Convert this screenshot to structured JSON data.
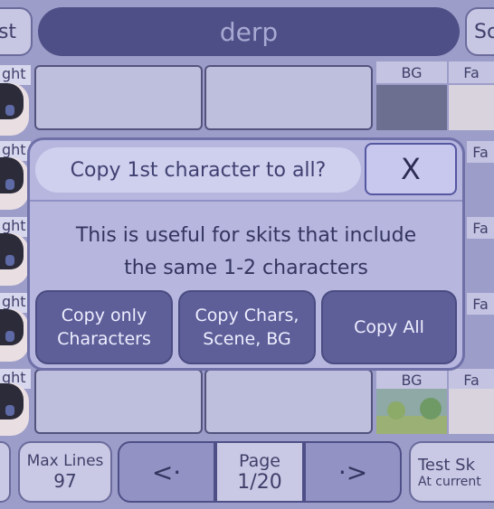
{
  "header": {
    "left_button_label": "st",
    "project_title": "derp",
    "right_button_label": "Sc"
  },
  "rows": [
    {
      "label": "ght"
    },
    {
      "label": "ght"
    },
    {
      "label": "ght"
    },
    {
      "label": "ght"
    },
    {
      "label": "ght"
    }
  ],
  "columns": {
    "bg_label": "BG",
    "face_label": "Fa"
  },
  "modal": {
    "title": "Copy 1st character to all?",
    "close_label": "X",
    "body_line1": "This is useful for skits that include",
    "body_line2": "the same 1-2 characters",
    "choices": [
      {
        "line1": "Copy only",
        "line2": "Characters"
      },
      {
        "line1": "Copy Chars,",
        "line2": "Scene, BG"
      },
      {
        "line1": "Copy All",
        "line2": ""
      }
    ]
  },
  "footer": {
    "max_lines_label": "Max Lines",
    "max_lines_value": "97",
    "prev_label": "<·",
    "page_label": "Page",
    "page_value": "1/20",
    "next_label": "·>",
    "test_label": "Test Sk",
    "test_sub": "At current"
  },
  "colors": {
    "overlay": "#9d9dca",
    "accent": "#5e5f99",
    "title_pill": "#4e4f86"
  }
}
